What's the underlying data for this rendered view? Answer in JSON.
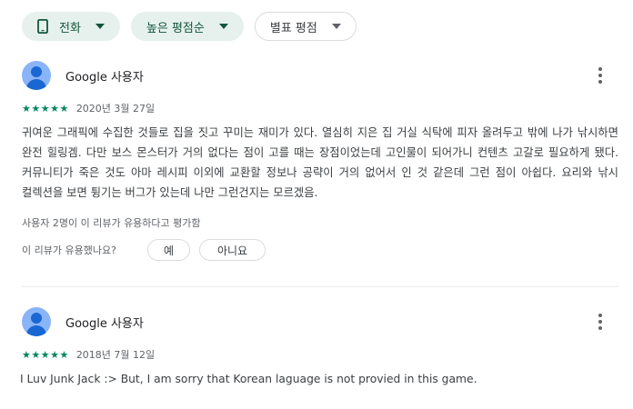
{
  "filters": [
    {
      "label": "전화",
      "icon": "phone-icon",
      "style": "filled"
    },
    {
      "label": "높은 평점순",
      "icon": null,
      "style": "filled"
    },
    {
      "label": "별표 평점",
      "icon": null,
      "style": "outlined"
    }
  ],
  "colors": {
    "accent": "#01875f",
    "chip_bg": "#e6f1ee",
    "chip_text": "#12563a",
    "avatar_light": "#8ab4f8",
    "avatar_dark": "#1967d2"
  },
  "reviews": [
    {
      "reviewer": "Google 사용자",
      "stars": "★★★★★",
      "rating": 5,
      "date": "2020년 3월 27일",
      "text": "귀여운 그래픽에 수집한 것들로 집을 짓고 꾸미는 재미가 있다. 열심히 지은 집 거실 식탁에 피자 올려두고 밖에 나가 낚시하면 완전 힐링겜. 다만 보스 몬스터가 거의 없다는 점이 고를 때는 장점이었는데 고인물이 되어가니 컨텐츠 고갈로 필요하게 됐다. 커뮤니티가 죽은 것도 아마 레시피 이외에 교환할 정보나 공략이 거의 없어서 인 것 같은데 그런 점이 아쉽다. 요리와 낚시 컬렉션을 보면 튕기는 버그가 있는데 나만 그런건지는 모르겠음.",
      "helpful_count": "사용자 2명이 이 리뷰가 유용하다고 평가함",
      "helpful_question": "이 리뷰가 유용했나요?",
      "yes_label": "예",
      "no_label": "아니요"
    },
    {
      "reviewer": "Google 사용자",
      "stars": "★★★★★",
      "rating": 5,
      "date": "2018년 7월 12일",
      "text": "I Luv Junk Jack :> But, I am sorry that Korean laguage is not provied in this game."
    }
  ]
}
